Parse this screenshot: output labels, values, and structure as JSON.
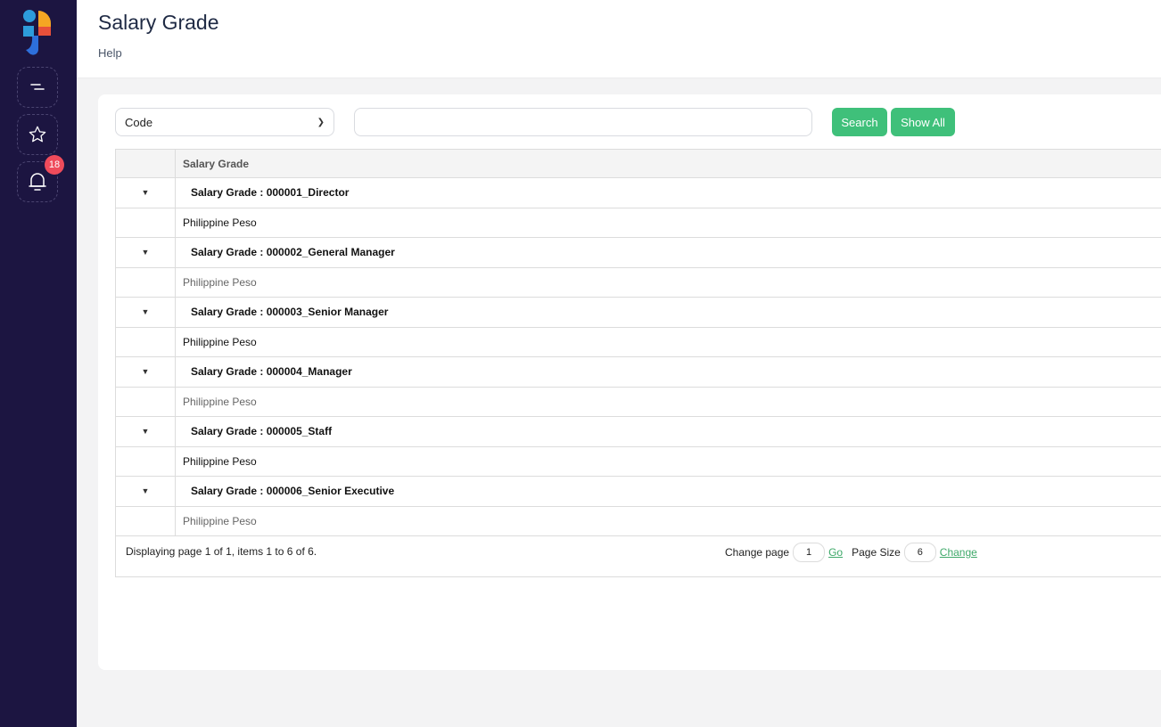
{
  "sidebar": {
    "notification_count": "18"
  },
  "header": {
    "title": "Salary Grade",
    "help": "Help"
  },
  "filter": {
    "selected_field": "Code",
    "search_value": "",
    "search_label": "Search",
    "show_all_label": "Show All"
  },
  "grid": {
    "column_header": "Salary Grade",
    "groups": [
      {
        "title": "Salary Grade : 000001_Director",
        "currency": "Philippine Peso"
      },
      {
        "title": "Salary Grade : 000002_General Manager",
        "currency": "Philippine Peso"
      },
      {
        "title": "Salary Grade : 000003_Senior Manager",
        "currency": "Philippine Peso"
      },
      {
        "title": "Salary Grade : 000004_Manager",
        "currency": "Philippine Peso"
      },
      {
        "title": "Salary Grade : 000005_Staff",
        "currency": "Philippine Peso"
      },
      {
        "title": "Salary Grade : 000006_Senior Executive",
        "currency": "Philippine Peso"
      }
    ]
  },
  "pager": {
    "info": "Displaying page 1 of 1, items 1 to 6 of 6.",
    "change_page_label": "Change page",
    "page_value": "1",
    "go_label": "Go",
    "page_size_label": "Page Size",
    "page_size_value": "6",
    "change_label": "Change"
  },
  "colors": {
    "sidebar_bg": "#1c1541",
    "accent_green": "#3fc07a",
    "badge_red": "#ef4b5b"
  }
}
